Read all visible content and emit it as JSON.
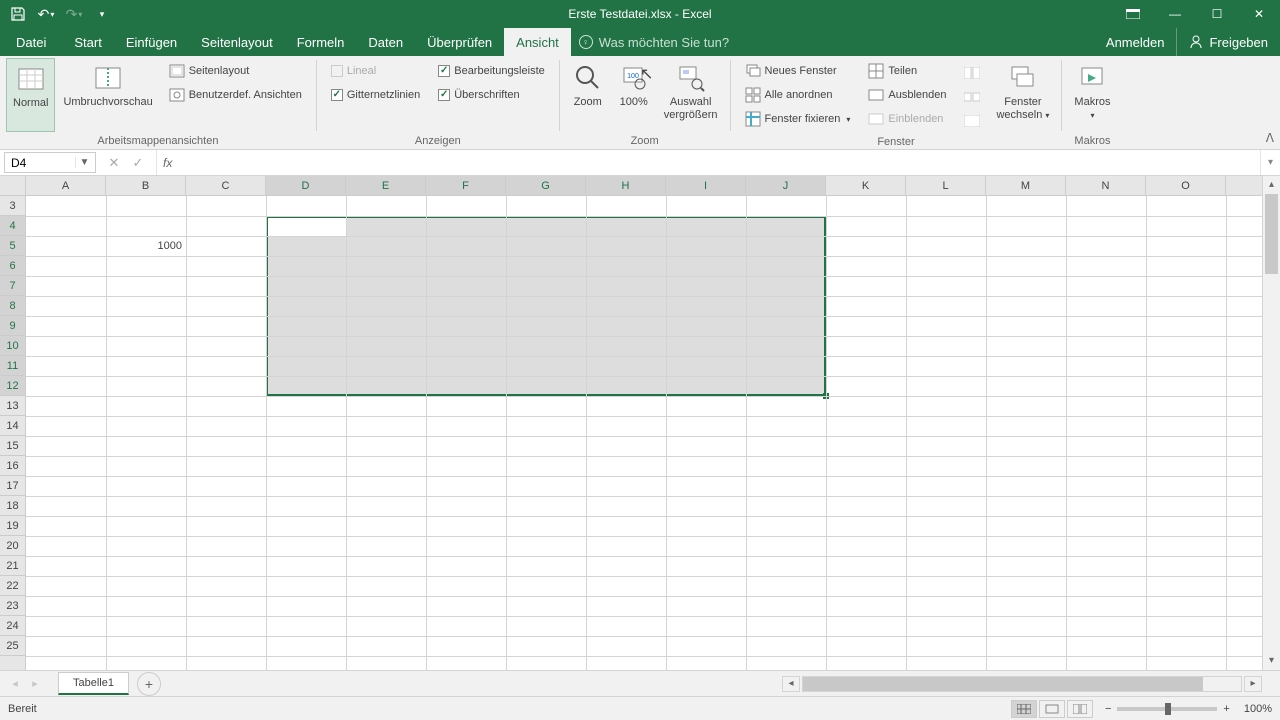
{
  "title": "Erste Testdatei.xlsx - Excel",
  "qat": {
    "save": "Save",
    "undo": "Undo",
    "redo": "Redo"
  },
  "win": {
    "opts": "Ribbon options",
    "min": "Minimize",
    "max": "Restore",
    "close": "Close"
  },
  "tabs": {
    "file": "Datei",
    "start": "Start",
    "insert": "Einfügen",
    "pagelayout": "Seitenlayout",
    "formulas": "Formeln",
    "data": "Daten",
    "review": "Überprüfen",
    "view": "Ansicht"
  },
  "tellme": "Was möchten Sie tun?",
  "auth": {
    "signin": "Anmelden",
    "share": "Freigeben"
  },
  "ribbon": {
    "views": {
      "normal": "Normal",
      "pagebreak": "Umbruchvorschau",
      "pagelayout": "Seitenlayout",
      "custom": "Benutzerdef. Ansichten",
      "group": "Arbeitsmappenansichten"
    },
    "show": {
      "ruler": "Lineal",
      "formula": "Bearbeitungsleiste",
      "grid": "Gitternetzlinien",
      "headings": "Überschriften",
      "group": "Anzeigen"
    },
    "zoom": {
      "zoom": "Zoom",
      "p100": "100%",
      "zoomsel1": "Auswahl",
      "zoomsel2": "vergrößern",
      "group": "Zoom"
    },
    "window": {
      "neww": "Neues Fenster",
      "arrange": "Alle anordnen",
      "freeze": "Fenster fixieren",
      "split": "Teilen",
      "hide": "Ausblenden",
      "unhide": "Einblenden",
      "switch1": "Fenster",
      "switch2": "wechseln",
      "group": "Fenster"
    },
    "macros": {
      "macros": "Makros",
      "group": "Makros"
    }
  },
  "namebox": "D4",
  "sheet": "Tabelle1",
  "status": "Bereit",
  "zoomText": "100%",
  "columns": [
    "A",
    "B",
    "C",
    "D",
    "E",
    "F",
    "G",
    "H",
    "I",
    "J",
    "K",
    "L",
    "M",
    "N",
    "O"
  ],
  "rows": [
    "3",
    "4",
    "5",
    "6",
    "7",
    "8",
    "9",
    "10",
    "11",
    "12",
    "13",
    "14",
    "15",
    "16",
    "17",
    "18",
    "19",
    "20",
    "21",
    "22",
    "23",
    "24",
    "25"
  ],
  "cellB5": "1000",
  "selection": {
    "active": "D4",
    "range": "D4:J12"
  },
  "chart_data": null
}
